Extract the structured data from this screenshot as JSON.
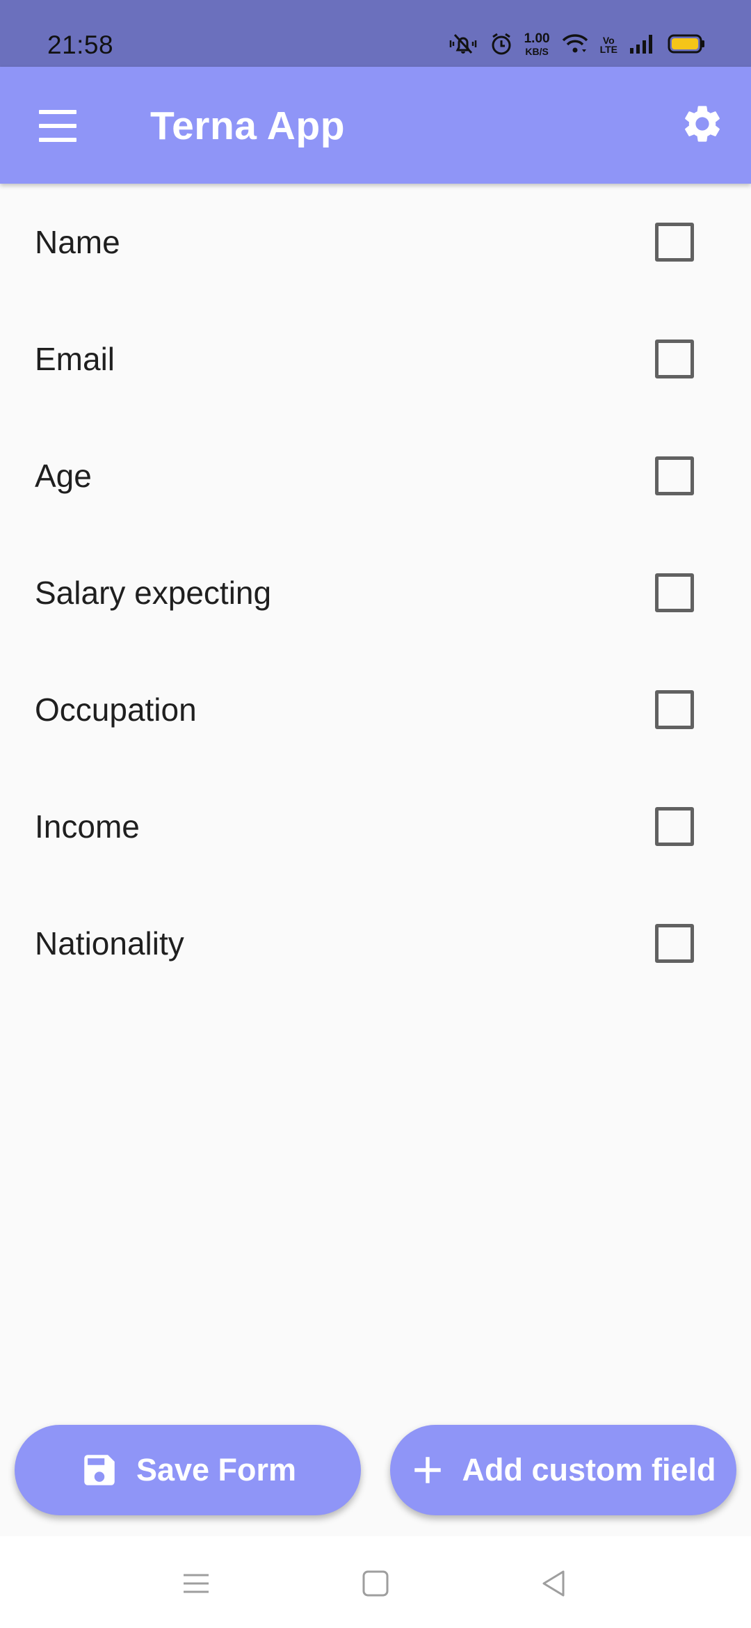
{
  "status_bar": {
    "time": "21:58",
    "speed_value": "1.00",
    "speed_unit": "KB/S",
    "volte_line1": "Vo",
    "volte_line2": "LTE",
    "icons": [
      "mute-icon",
      "alarm-icon",
      "wifi-icon",
      "volte-icon",
      "signal-icon",
      "battery-icon"
    ],
    "battery_color": "#f5c518"
  },
  "appbar": {
    "title": "Terna App",
    "color": "#8f95f7",
    "icons": [
      "menu-icon",
      "settings-icon"
    ]
  },
  "fields": [
    {
      "label": "Name",
      "checked": false
    },
    {
      "label": "Email",
      "checked": false
    },
    {
      "label": "Age",
      "checked": false
    },
    {
      "label": "Salary expecting",
      "checked": false
    },
    {
      "label": "Occupation",
      "checked": false
    },
    {
      "label": "Income",
      "checked": false
    },
    {
      "label": "Nationality",
      "checked": false
    }
  ],
  "actions": {
    "save_label": "Save Form",
    "save_icon": "save-icon",
    "add_label": "Add custom field",
    "add_icon": "plus-icon"
  },
  "navbar": {
    "icons": [
      "recents-icon",
      "home-icon",
      "back-icon"
    ]
  }
}
